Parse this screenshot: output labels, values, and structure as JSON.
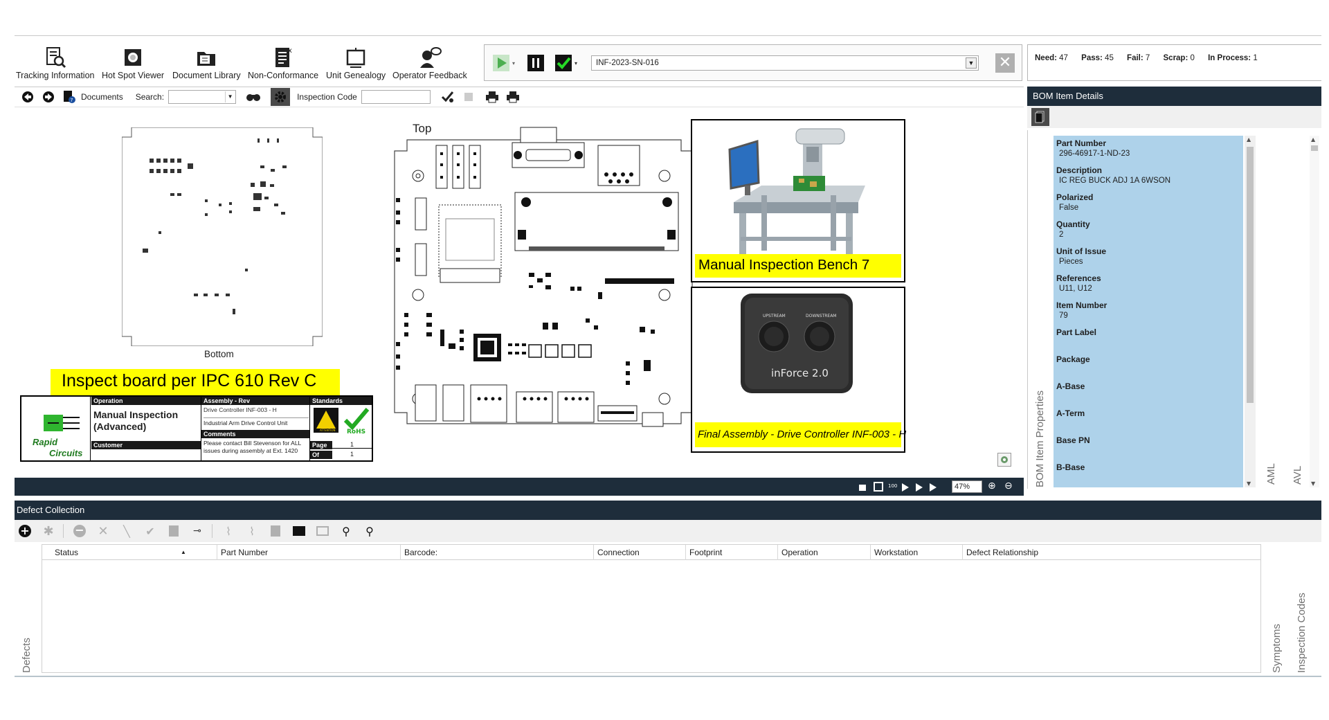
{
  "toolbar": {
    "tracking": "Tracking Information",
    "hotspot": "Hot Spot Viewer",
    "doclib": "Document Library",
    "nonconf": "Non-Conformance",
    "genealogy": "Unit Genealogy",
    "feedback": "Operator Feedback"
  },
  "serial": {
    "value": "INF-2023-SN-016"
  },
  "counts": {
    "need_label": "Need:",
    "need": "47",
    "pass_label": "Pass:",
    "pass": "45",
    "fail_label": "Fail:",
    "fail": "7",
    "scrap_label": "Scrap:",
    "scrap": "0",
    "inproc_label": "In Process:",
    "inproc": "1"
  },
  "subbar": {
    "documents": "Documents",
    "search": "Search:",
    "inspection_code": "Inspection Code"
  },
  "canvas": {
    "top_label": "Top",
    "bottom_label": "Bottom",
    "instruction": "Inspect board per IPC 610 Rev C",
    "bench_label": "Manual Inspection Bench 7",
    "assembly_label": "Final Assembly - Drive Controller INF-003 - H",
    "device_brand": "inForce 2.0",
    "device_port1": "UPSTREAM",
    "device_port2": "DOWNSTREAM"
  },
  "title_block": {
    "logo_line1": "Rapid",
    "logo_line2": "Circuits",
    "operation_hdr": "Operation",
    "operation": "Manual Inspection (Advanced)",
    "customer_hdr": "Customer",
    "assembly_hdr": "Assembly - Rev",
    "assembly1": "Drive Controller INF-003 - H",
    "assembly2": "Industrial Arm Drive Control Unit",
    "comments_hdr": "Comments",
    "comments": "Please contact Bill Stevenson for ALL issues during assembly at Ext. 1420",
    "standards_hdr": "Standards",
    "esd": "ATTENTION",
    "rohs": "RoHS",
    "page_hdr": "Page",
    "page": "1",
    "of_hdr": "Of",
    "of": "1"
  },
  "zoom": {
    "value": "47%"
  },
  "bom": {
    "header": "BOM Item Details",
    "props_tab": "BOM Item Properties",
    "aml_tab": "AML",
    "avl_tab": "AVL",
    "items": [
      {
        "k": "Part Number",
        "v": "296-46917-1-ND-23"
      },
      {
        "k": "Description",
        "v": "IC REG BUCK ADJ 1A 6WSON"
      },
      {
        "k": "Polarized",
        "v": "False"
      },
      {
        "k": "Quantity",
        "v": "2"
      },
      {
        "k": "Unit of Issue",
        "v": "Pieces"
      },
      {
        "k": "References",
        "v": "U11, U12"
      },
      {
        "k": "Item Number",
        "v": "79"
      },
      {
        "k": "Part Label",
        "v": ""
      },
      {
        "k": "Package",
        "v": ""
      },
      {
        "k": "A-Base",
        "v": ""
      },
      {
        "k": "A-Term",
        "v": ""
      },
      {
        "k": "Base PN",
        "v": ""
      },
      {
        "k": "B-Base",
        "v": ""
      }
    ]
  },
  "defects": {
    "header": "Defect Collection",
    "tab": "Defects",
    "symptoms_tab": "Symptoms",
    "codes_tab": "Inspection Codes",
    "columns": [
      "Status",
      "Part Number",
      "Barcode:",
      "Connection",
      "Footprint",
      "Operation",
      "Workstation",
      "Defect Relationship"
    ]
  }
}
